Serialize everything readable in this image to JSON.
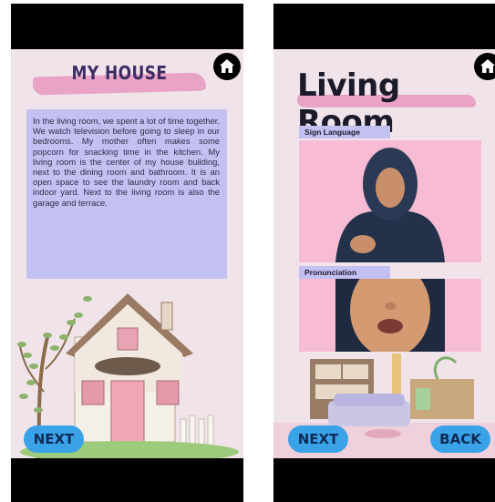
{
  "left_screen": {
    "title": "MY HOUSE",
    "story": "In the living room, we spent a lot of time together. We watch television before going to sleep in our bedrooms. My mother often makes some popcorn for snacking time in the kitchen. My living room is the center of my house building, next to the dining room and bathroom. It is an open space to see the laundry room and back indoor yard. Next to the living room is also the garage and terrace.",
    "next_label": "NEXT",
    "home_icon": "home-icon"
  },
  "right_screen": {
    "title": "Living Room",
    "sign_language_label": "Sign Language",
    "pronunciation_label": "Pronunciation",
    "next_label": "NEXT",
    "back_label": "BACK",
    "home_icon": "home-icon"
  },
  "colors": {
    "background": "#f0e4ea",
    "accent_pink": "#e9a3c5",
    "lavender": "#c3c1f2",
    "button_blue": "#3aa3e8",
    "panel_pink": "#f7bcd3"
  }
}
